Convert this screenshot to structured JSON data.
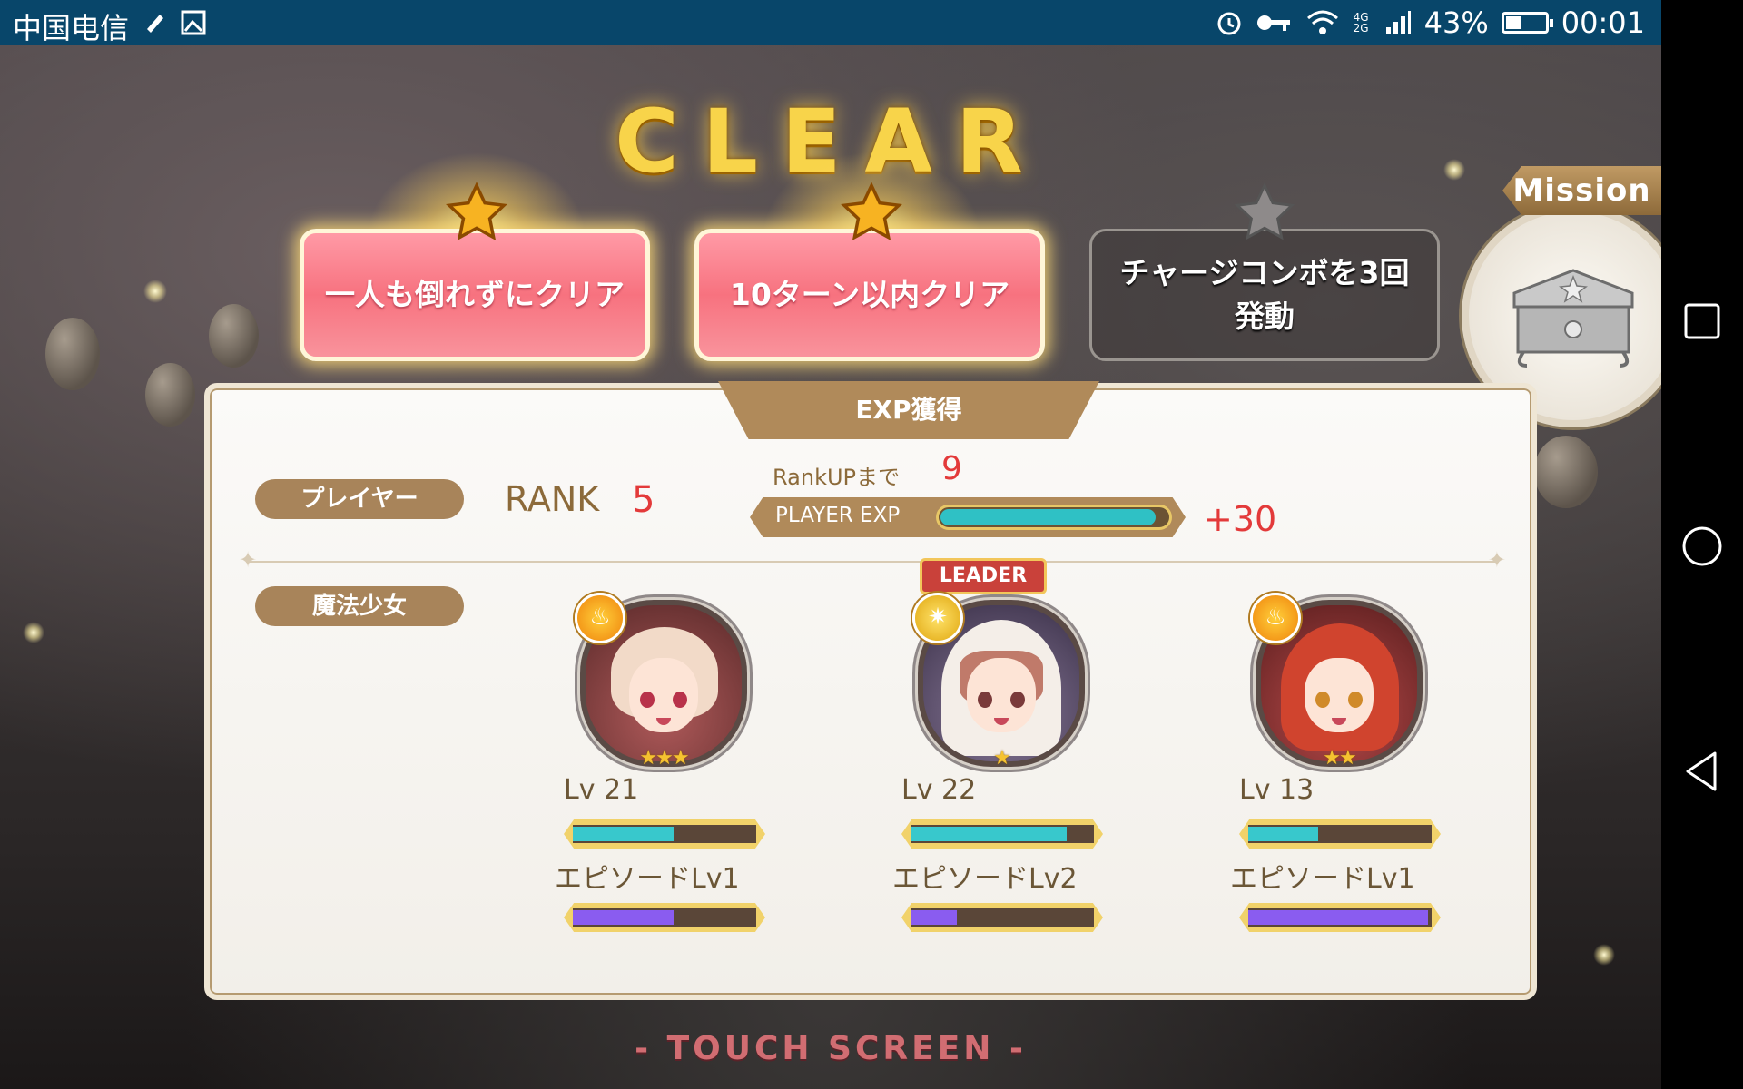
{
  "status_bar": {
    "carrier": "中国电信",
    "network": "4G 2G",
    "battery_text": "43%",
    "battery_level": 0.43,
    "time": "00:01"
  },
  "game": {
    "title": "CLEAR",
    "missions": [
      {
        "text": "一人も倒れずにクリア",
        "achieved": true
      },
      {
        "text": "10ターン以内クリア",
        "achieved": true
      },
      {
        "text_line1": "チャージコンボを3回",
        "text_line2": "発動",
        "achieved": false
      }
    ],
    "mission_button_label": "Mission",
    "panel_title": "EXP獲得",
    "player": {
      "label": "プレイヤー",
      "rank_word": "RANK",
      "rank": "5",
      "rankup_label": "RankUPまで",
      "rankup_value": "9",
      "exp_label": "PLAYER EXP",
      "exp_fill": 0.95,
      "exp_gain": "+30"
    },
    "girls_label": "魔法少女",
    "leader_label": "LEADER",
    "characters": [
      {
        "lv": "Lv 21",
        "lv_fill": 0.55,
        "episode": "エピソードLv1",
        "ep_fill": 0.55,
        "stars": "★★★",
        "attr": "fire"
      },
      {
        "lv": "Lv 22",
        "lv_fill": 0.85,
        "episode": "エピソードLv2",
        "ep_fill": 0.25,
        "stars": "★",
        "attr": "light"
      },
      {
        "lv": "Lv 13",
        "lv_fill": 0.38,
        "episode": "エピソードLv1",
        "ep_fill": 0.98,
        "stars": "★★",
        "attr": "fire"
      }
    ],
    "touch_prompt": "- TOUCH SCREEN -",
    "colors": {
      "accent_gold": "#f8d44a",
      "rank_red": "#e33a3a",
      "label_brown": "#a8845a"
    }
  }
}
